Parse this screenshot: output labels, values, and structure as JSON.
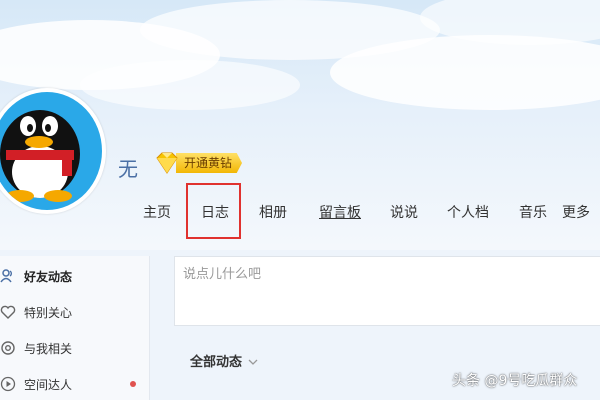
{
  "profile": {
    "name": "无",
    "vip_label": "开通黄钻",
    "avatar_alt": "qq-penguin-avatar"
  },
  "nav": {
    "items": [
      {
        "label": "主页"
      },
      {
        "label": "日志",
        "highlighted": true
      },
      {
        "label": "相册"
      },
      {
        "label": "留言板",
        "underlined": true
      },
      {
        "label": "说说"
      },
      {
        "label": "个人档"
      },
      {
        "label": "音乐"
      },
      {
        "label": "更多"
      }
    ],
    "highlight_color": "#e0322f"
  },
  "sidebar": {
    "items": [
      {
        "label": "好友动态",
        "icon": "friends-icon",
        "active": true
      },
      {
        "label": "特别关心",
        "icon": "heart-icon"
      },
      {
        "label": "与我相关",
        "icon": "at-icon"
      },
      {
        "label": "空间达人",
        "icon": "play-icon",
        "has_dot": true
      }
    ]
  },
  "composer": {
    "placeholder": "说点儿什么吧"
  },
  "feed": {
    "filter_label": "全部动态"
  },
  "watermark": {
    "text": "头条 @9号吃瓜群众"
  },
  "colors": {
    "accent_blue": "#4a6fa5",
    "vip_gold": "#f2b705",
    "badge_red": "#e0524f"
  }
}
